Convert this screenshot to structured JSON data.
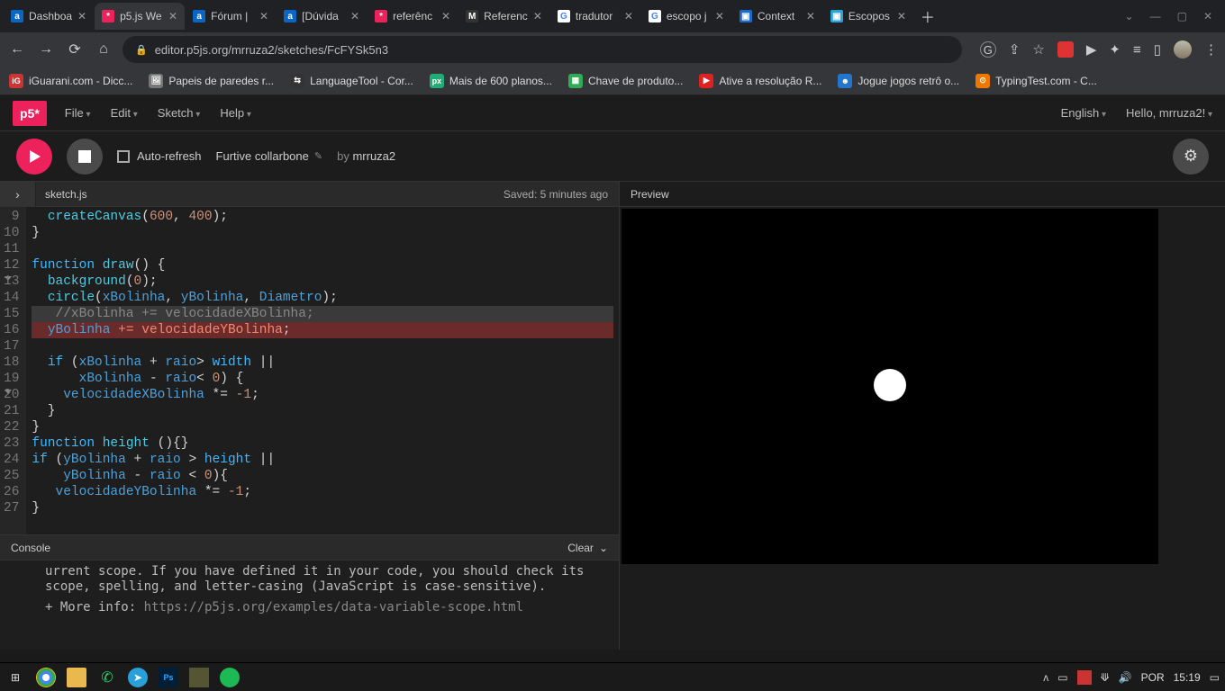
{
  "browser": {
    "tabs": [
      {
        "title": "Dashboa",
        "fav_bg": "#0b66c3",
        "fav_tx": "a"
      },
      {
        "title": "p5.js We",
        "fav_bg": "#ed225d",
        "fav_tx": "*",
        "active": true
      },
      {
        "title": "Fórum |",
        "fav_bg": "#0b66c3",
        "fav_tx": "a"
      },
      {
        "title": "[Dúvida",
        "fav_bg": "#0b66c3",
        "fav_tx": "a"
      },
      {
        "title": "referênc",
        "fav_bg": "#ed225d",
        "fav_tx": "*"
      },
      {
        "title": "Referenc",
        "fav_bg": "#333",
        "fav_tx": "M"
      },
      {
        "title": "tradutor",
        "fav_bg": "#fff",
        "fav_tx": "G"
      },
      {
        "title": "escopo j",
        "fav_bg": "#fff",
        "fav_tx": "G"
      },
      {
        "title": "Context",
        "fav_bg": "#1b6ac9",
        "fav_tx": "▣"
      },
      {
        "title": "Escopos",
        "fav_bg": "#2aa3dc",
        "fav_tx": "▣"
      }
    ],
    "url": "editor.p5js.org/mrruza2/sketches/FcFYSk5n3",
    "bookmarks": [
      {
        "label": "iGuarani.com - Dicc...",
        "bg": "#c33",
        "tx": "iG"
      },
      {
        "label": "Papeis de paredes r...",
        "bg": "#777",
        "tx": "🖼"
      },
      {
        "label": "LanguageTool - Cor...",
        "bg": "#333",
        "tx": "⇆"
      },
      {
        "label": "Mais de 600 planos...",
        "bg": "#2a7",
        "tx": "px"
      },
      {
        "label": "Chave de produto...",
        "bg": "#3a5",
        "tx": "▦"
      },
      {
        "label": "Ative a resolução R...",
        "bg": "#d22",
        "tx": "▶"
      },
      {
        "label": "Jogue jogos retrô o...",
        "bg": "#27c",
        "tx": "☻"
      },
      {
        "label": "TypingTest.com - C...",
        "bg": "#e70",
        "tx": "⊙"
      }
    ]
  },
  "p5": {
    "logo": "p5*",
    "menu": [
      "File",
      "Edit",
      "Sketch",
      "Help"
    ],
    "lang": "English",
    "hello": "Hello, mrruza2!",
    "auto_refresh": "Auto-refresh",
    "sketch_name": "Furtive collarbone",
    "by_label": "by",
    "by_user": "mrruza2",
    "file_tab": "sketch.js",
    "saved": "Saved: 5 minutes ago",
    "preview_label": "Preview",
    "console_label": "Console",
    "clear_label": "Clear",
    "console_text": "urrent scope. If you have defined it in your code, you should check its scope, spelling, and letter-casing (JavaScript is case-sensitive).",
    "console_more": "+ More info: ",
    "console_link": "https://p5js.org/examples/data-variable-scope.html"
  },
  "code": {
    "lines": [
      {
        "n": 9
      },
      {
        "n": 10
      },
      {
        "n": 11
      },
      {
        "n": 12,
        "fold": true
      },
      {
        "n": 13
      },
      {
        "n": 14
      },
      {
        "n": 15
      },
      {
        "n": 16
      },
      {
        "n": 17
      },
      {
        "n": 18
      },
      {
        "n": 19,
        "fold": true
      },
      {
        "n": 20
      },
      {
        "n": 21
      },
      {
        "n": 22
      },
      {
        "n": 23
      },
      {
        "n": 24
      },
      {
        "n": 25
      },
      {
        "n": 26
      },
      {
        "n": 27
      }
    ]
  },
  "taskbar": {
    "lang": "POR",
    "time": "15:19"
  }
}
